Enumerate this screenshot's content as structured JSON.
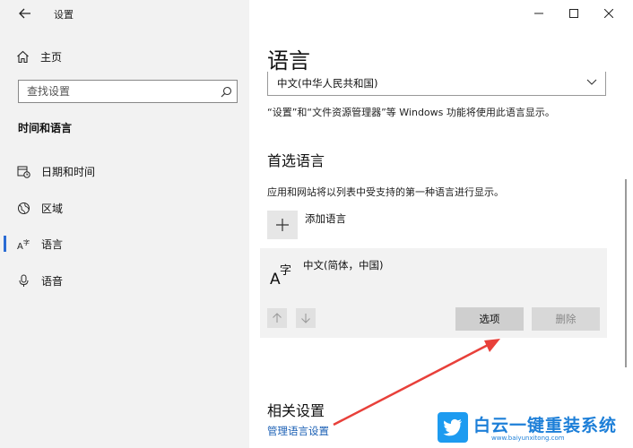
{
  "window": {
    "title": "设置"
  },
  "sidebar": {
    "home_label": "主页",
    "search_placeholder": "查找设置",
    "section_title": "时间和语言",
    "items": [
      {
        "label": "日期和时间",
        "icon": "calendar-clock-icon"
      },
      {
        "label": "区域",
        "icon": "globe-icon"
      },
      {
        "label": "语言",
        "icon": "language-icon",
        "selected": true
      },
      {
        "label": "语音",
        "icon": "microphone-icon"
      }
    ]
  },
  "main": {
    "title": "语言",
    "display_language": "中文(中华人民共和国)",
    "display_desc": "“设置”和“文件资源管理器”等 Windows 功能将使用此语言显示。",
    "preferred_title": "首选语言",
    "preferred_desc": "应用和网站将以列表中受支持的第一种语言进行显示。",
    "add_language_label": "添加语言",
    "language_entry": "中文(简体，中国)",
    "options_label": "选项",
    "remove_label": "删除",
    "related_title": "相关设置",
    "manage_link": "管理语言设置"
  },
  "watermark": {
    "text": "白云一键重装系统",
    "url": "www.baiyunxitong.com"
  },
  "colors": {
    "accent": "#2b6cd4",
    "link": "#1a5fb4",
    "arrow": "#e8403a",
    "watermark": "#1d7fd8"
  }
}
